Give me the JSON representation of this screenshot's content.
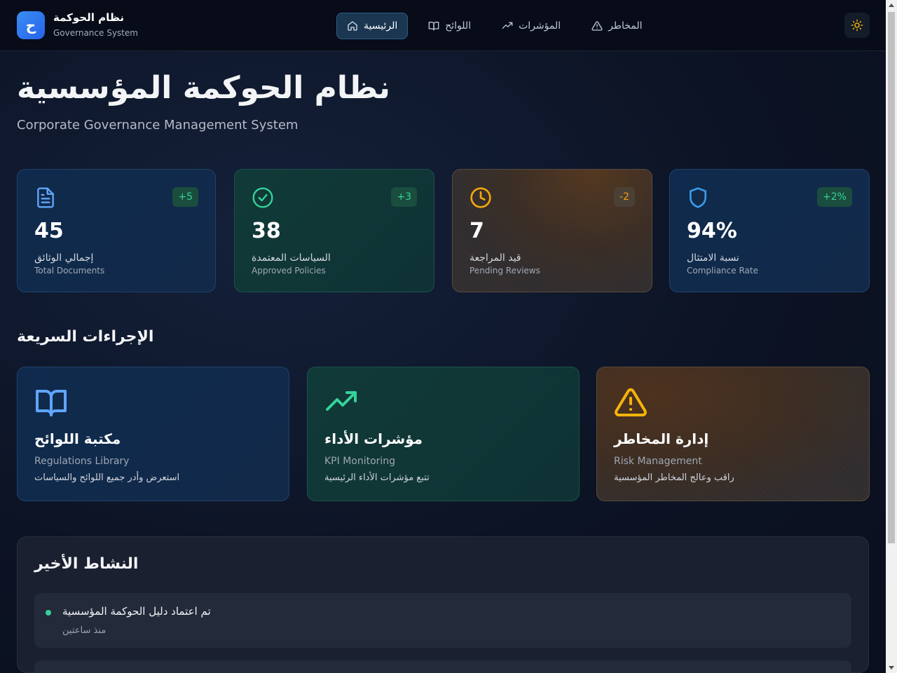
{
  "header": {
    "logo_letter": "ح",
    "brand_ar": "نظام الحوكمة",
    "brand_en": "Governance System",
    "nav": [
      {
        "label": "الرئيسية",
        "icon": "home-icon",
        "active": true
      },
      {
        "label": "اللوائح",
        "icon": "book-icon",
        "active": false
      },
      {
        "label": "المؤشرات",
        "icon": "trending-up-icon",
        "active": false
      },
      {
        "label": "المخاطر",
        "icon": "warning-icon",
        "active": false
      }
    ],
    "theme_icon": "sun-icon"
  },
  "hero": {
    "title": "نظام الحوكمة المؤسسية",
    "subtitle": "Corporate Governance Management System"
  },
  "stats": [
    {
      "icon": "document-icon",
      "badge": "+5",
      "value": "45",
      "label_ar": "إجمالي الوثائق",
      "label_en": "Total Documents",
      "color": "#60a5fa"
    },
    {
      "icon": "check-circle-icon",
      "badge": "+3",
      "value": "38",
      "label_ar": "السياسات المعتمدة",
      "label_en": "Approved Policies",
      "color": "#34d399"
    },
    {
      "icon": "clock-icon",
      "badge": "-2",
      "value": "7",
      "label_ar": "قيد المراجعة",
      "label_en": "Pending Reviews",
      "color": "#f59e0b"
    },
    {
      "icon": "shield-icon",
      "badge": "+2%",
      "value": "94%",
      "label_ar": "نسبة الامتثال",
      "label_en": "Compliance Rate",
      "color": "#3b9ae8"
    }
  ],
  "quick_actions": {
    "title": "الإجراءات السريعة",
    "items": [
      {
        "icon": "book-open-icon",
        "title": "مكتبة اللوائح",
        "title_en": "Regulations Library",
        "desc": "استعرض وأدر جميع اللوائح والسياسات",
        "color": "#60a5fa"
      },
      {
        "icon": "trending-up-icon",
        "title": "مؤشرات الأداء",
        "title_en": "KPI Monitoring",
        "desc": "تتبع مؤشرات الأداء الرئيسية",
        "color": "#34d399"
      },
      {
        "icon": "warning-triangle-icon",
        "title": "إدارة المخاطر",
        "title_en": "Risk Management",
        "desc": "راقب وعالج المخاطر المؤسسية",
        "color": "#f5b40b"
      }
    ]
  },
  "activity": {
    "title": "النشاط الأخير",
    "items": [
      {
        "text": "تم اعتماد دليل الحوكمة المؤسسية",
        "time": "منذ ساعتين"
      }
    ]
  }
}
